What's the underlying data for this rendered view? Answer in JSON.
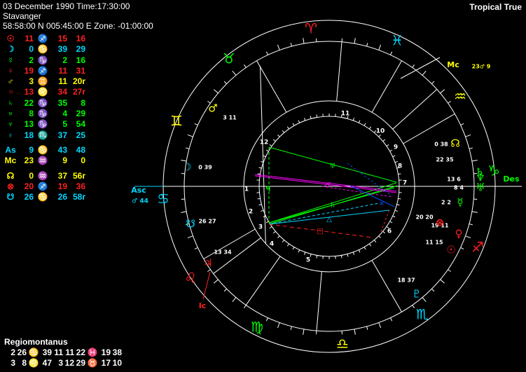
{
  "header": {
    "date_time": "03 December 1990 Time:17:30:00",
    "place": "Stavanger",
    "coords": "58:58:00 N 005:45:00 E Zone: -01:00:00"
  },
  "zodiac_type": "Tropical True",
  "planets": [
    {
      "sym": "☉",
      "deg": "11",
      "sign": "♐",
      "min": "15",
      "sec": "16",
      "color": "#ff2020"
    },
    {
      "sym": "☽",
      "deg": "0",
      "sign": "♋",
      "min": "39",
      "sec": "29",
      "color": "#00d8ff"
    },
    {
      "sym": "☿",
      "deg": "2",
      "sign": "♑",
      "min": "2",
      "sec": "16",
      "color": "#00ff00"
    },
    {
      "sym": "♀",
      "deg": "19",
      "sign": "♐",
      "min": "11",
      "sec": "31",
      "color": "#ff2020"
    },
    {
      "sym": "♂",
      "deg": "3",
      "sign": "♊",
      "min": "11",
      "sec": "20r",
      "color": "#ffff00"
    },
    {
      "sym": "♃",
      "deg": "13",
      "sign": "♌",
      "min": "34",
      "sec": "27r",
      "color": "#ff2020"
    },
    {
      "sym": "♄",
      "deg": "22",
      "sign": "♑",
      "min": "35",
      "sec": "8",
      "color": "#00ff00"
    },
    {
      "sym": "♅",
      "deg": "8",
      "sign": "♑",
      "min": "4",
      "sec": "29",
      "color": "#00ff00"
    },
    {
      "sym": "♆",
      "deg": "13",
      "sign": "♑",
      "min": "5",
      "sec": "54",
      "color": "#00ff00"
    },
    {
      "sym": "♇",
      "deg": "18",
      "sign": "♏",
      "min": "37",
      "sec": "25",
      "color": "#00d8ff"
    }
  ],
  "angles": [
    {
      "sym": "As",
      "deg": "9",
      "sign": "♋",
      "min": "43",
      "sec": "48",
      "color": "#00d8ff"
    },
    {
      "sym": "Mc",
      "deg": "23",
      "sign": "♒",
      "min": "9",
      "sec": "0",
      "color": "#ffff00"
    }
  ],
  "points": [
    {
      "sym": "☊",
      "deg": "0",
      "sign": "♒",
      "min": "37",
      "sec": "56r",
      "color": "#ffff00"
    },
    {
      "sym": "⊗",
      "deg": "20",
      "sign": "♐",
      "min": "19",
      "sec": "36",
      "color": "#ff2020"
    },
    {
      "sym": "☋",
      "deg": "26",
      "sign": "♋",
      "min": "26",
      "sec": "58r",
      "color": "#00d8ff"
    }
  ],
  "houses": {
    "title": "Regiomontanus",
    "row1": [
      "2",
      "26",
      "♋",
      "39",
      "11",
      "11",
      "22",
      "♓",
      "19",
      "38"
    ],
    "row2": [
      "3",
      "8",
      "♌",
      "47",
      "3",
      "12",
      "29",
      "♉",
      "17",
      "10"
    ]
  },
  "chart": {
    "asc_label": "Asc",
    "asc_sub": "♂ 44",
    "des_label": "Des",
    "mc_label": "Mc",
    "mc_sub": "23♂ 9",
    "ic_label": "Ic",
    "house_numbers": [
      "1",
      "2",
      "3",
      "4",
      "5",
      "6",
      "7",
      "8",
      "9",
      "10",
      "11",
      "12"
    ],
    "sign_glyphs": [
      "♈",
      "♓",
      "♒",
      "♑",
      "♐",
      "♏",
      "♎",
      "♍",
      "♌",
      "♋",
      "♊",
      "♉"
    ],
    "placed": [
      {
        "g": "♂",
        "t": "3  11",
        "color": "#ffff00"
      },
      {
        "g": "☽",
        "t": "0  39",
        "color": "#00d8ff"
      },
      {
        "g": "☋",
        "t": "26 27",
        "color": "#00d8ff"
      },
      {
        "g": "♃",
        "t": "13 34",
        "color": "#ff2020"
      },
      {
        "g": "♇",
        "t": "18 37",
        "color": "#00d8ff"
      },
      {
        "g": "☉",
        "t": "11 15",
        "color": "#ff2020"
      },
      {
        "g": "♀",
        "t": "19 11",
        "color": "#ff2020"
      },
      {
        "g": "⊗",
        "t": "20 20",
        "color": "#ff2020"
      },
      {
        "g": "☿",
        "t": "2  2",
        "color": "#00ff00"
      },
      {
        "g": "♅",
        "t": "8  4",
        "color": "#00ff00"
      },
      {
        "g": "♆",
        "t": "13 6",
        "color": "#00ff00"
      },
      {
        "g": "♄",
        "t": "22 35",
        "color": "#00ff00"
      },
      {
        "g": "☊",
        "t": "0  38",
        "color": "#ffff00"
      }
    ]
  }
}
